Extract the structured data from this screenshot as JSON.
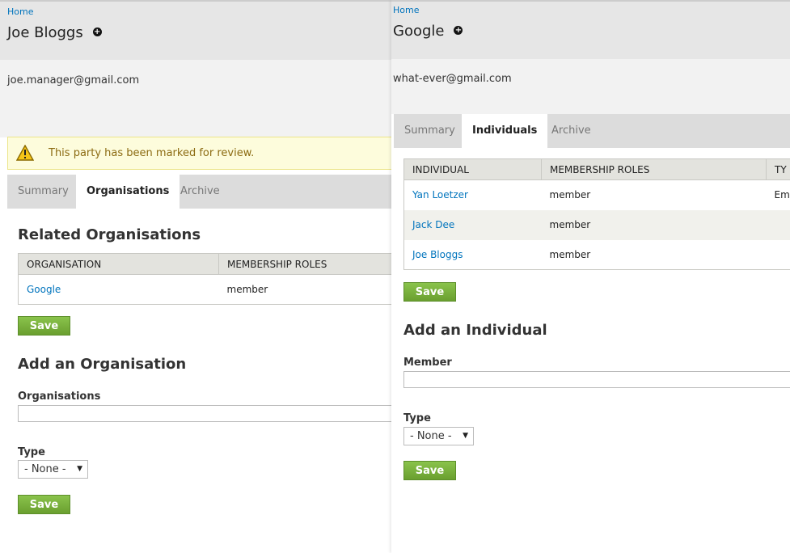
{
  "left": {
    "breadcrumb": "Home",
    "title": "Joe Bloggs",
    "email": "joe.manager@gmail.com",
    "warning": "This party has been marked for review.",
    "tabs": [
      {
        "label": "Summary",
        "active": false
      },
      {
        "label": "Organisations",
        "active": true
      },
      {
        "label": "Archive",
        "active": false
      }
    ],
    "related_title": "Related Organisations",
    "table": {
      "headers": [
        "ORGANISATION",
        "MEMBERSHIP ROLES"
      ],
      "rows": [
        {
          "name": "Google",
          "role": "member"
        }
      ]
    },
    "save_label": "Save",
    "add_title": "Add an Organisation",
    "field_label": "Organisations",
    "type_label": "Type",
    "type_value": "- None -",
    "save2_label": "Save"
  },
  "right": {
    "breadcrumb": "Home",
    "title": "Google",
    "email": "what-ever@gmail.com",
    "tabs": [
      {
        "label": "Summary",
        "active": false
      },
      {
        "label": "Individuals",
        "active": true
      },
      {
        "label": "Archive",
        "active": false
      }
    ],
    "table": {
      "headers": [
        "INDIVIDUAL",
        "MEMBERSHIP ROLES",
        "TY"
      ],
      "rows": [
        {
          "name": "Yan Loetzer",
          "role": "member",
          "type": "Em"
        },
        {
          "name": "Jack Dee",
          "role": "member",
          "type": ""
        },
        {
          "name": "Joe Bloggs",
          "role": "member",
          "type": ""
        }
      ]
    },
    "save_label": "Save",
    "add_title": "Add an Individual",
    "field_label": "Member",
    "type_label": "Type",
    "type_value": "- None -",
    "save2_label": "Save"
  },
  "colors": {
    "link": "#0074bd",
    "button_green": "#7ab33e",
    "warning_bg": "#fdfcdc"
  },
  "icons": {
    "add": "plus-circle-icon",
    "warning": "warning-triangle-icon",
    "dropdown": "caret-down-icon"
  }
}
